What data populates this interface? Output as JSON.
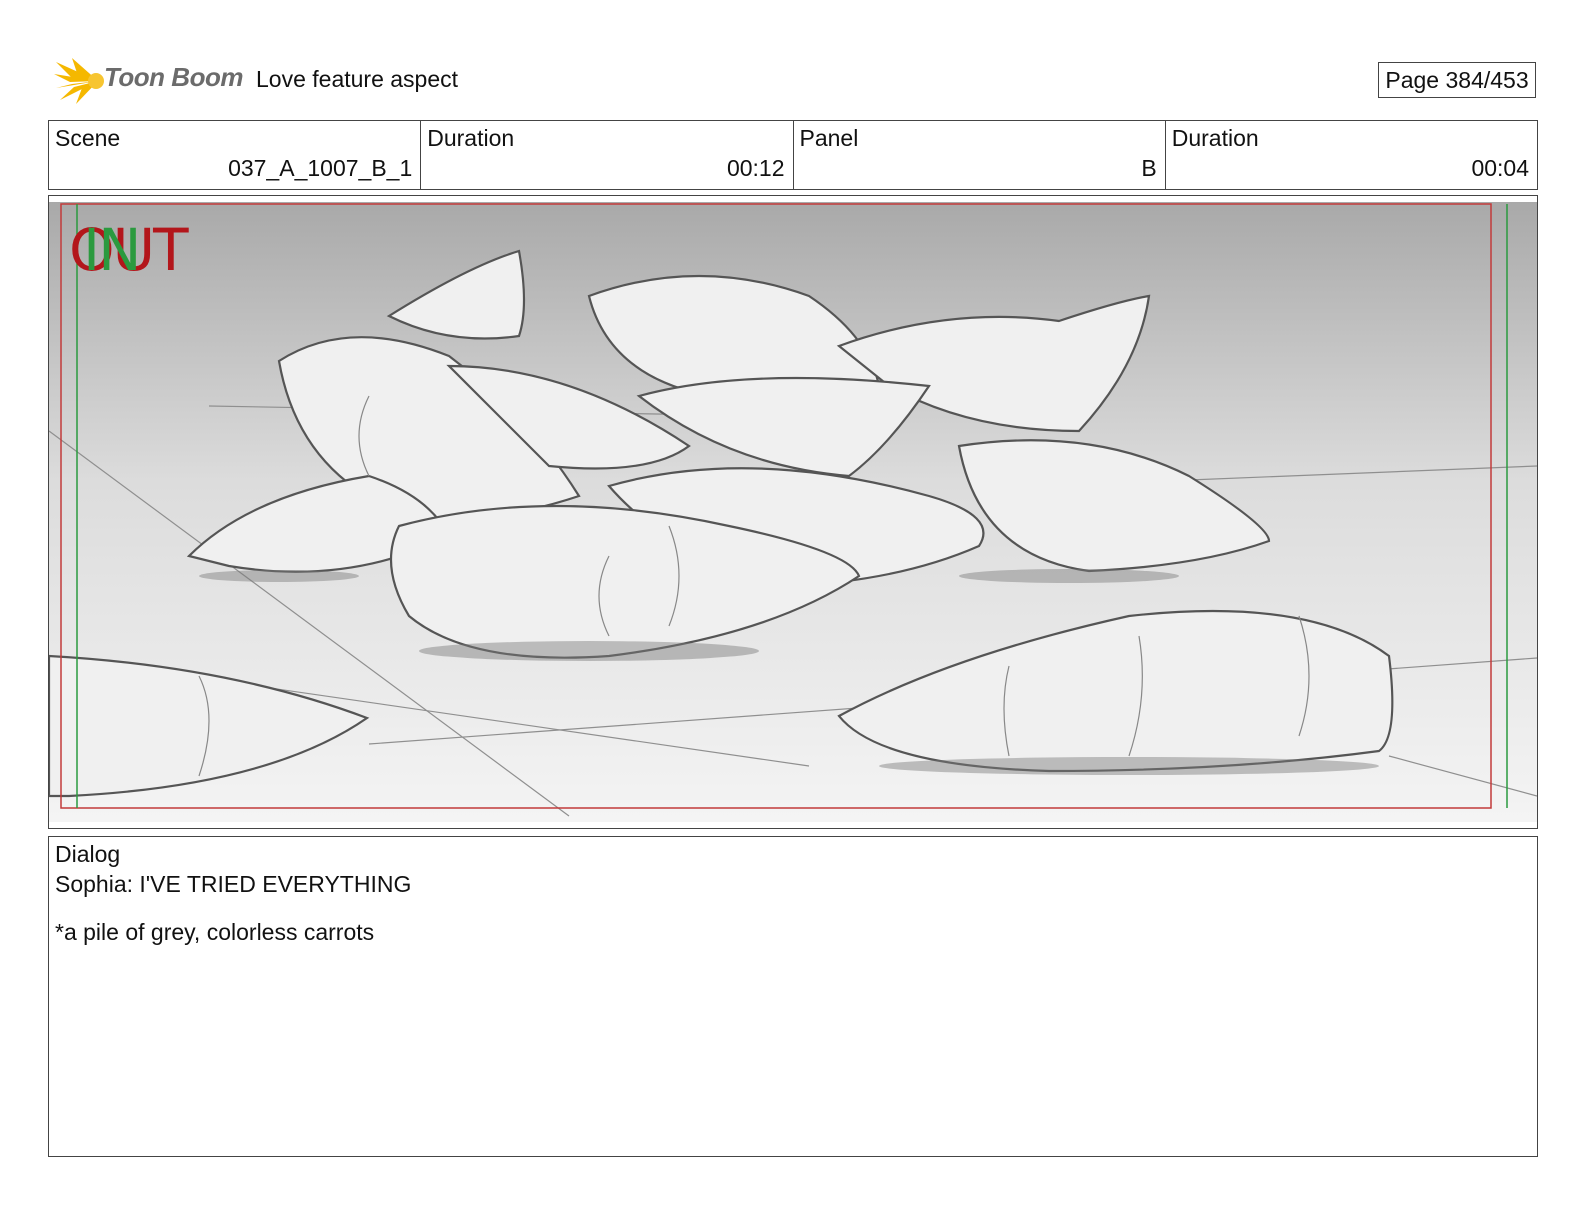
{
  "header": {
    "logo_text": "Toon Boom",
    "title": "Love feature aspect",
    "page": "Page 384/453"
  },
  "info": {
    "scene_label": "Scene",
    "scene_value": "037_A_1007_B_1",
    "duration_label": "Duration",
    "duration_value": "00:12",
    "panel_label": "Panel",
    "panel_value": "B",
    "panel_duration_label": "Duration",
    "panel_duration_value": "00:04"
  },
  "panel": {
    "out_marker": "OUT",
    "in_marker": "IN",
    "out_color": "#b3161b",
    "in_color": "#2b9a3f"
  },
  "dialog": {
    "label": "Dialog",
    "line": "Sophia: I'VE TRIED EVERYTHING",
    "note": "*a pile of grey, colorless carrots"
  },
  "colors": {
    "logo_accent": "#f5b800",
    "logo_text": "#6b6b6b",
    "border": "#444444"
  }
}
